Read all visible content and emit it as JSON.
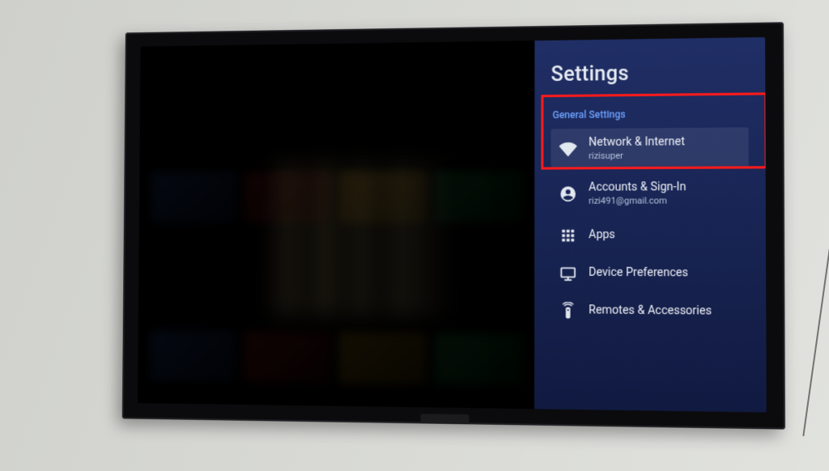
{
  "panel": {
    "title": "Settings",
    "section_header": "General Settings",
    "items": [
      {
        "id": "network-internet",
        "icon": "wifi-icon",
        "label": "Network & Internet",
        "sublabel": "rizisuper",
        "focused": true
      },
      {
        "id": "accounts-signin",
        "icon": "account-icon",
        "label": "Accounts & Sign-In",
        "sublabel": "rizi491@gmail.com",
        "focused": false
      },
      {
        "id": "apps",
        "icon": "apps-icon",
        "label": "Apps",
        "sublabel": null,
        "focused": false
      },
      {
        "id": "device-preferences",
        "icon": "display-icon",
        "label": "Device Preferences",
        "sublabel": null,
        "focused": false
      },
      {
        "id": "remotes-accessories",
        "icon": "remote-icon",
        "label": "Remotes & Accessories",
        "sublabel": null,
        "focused": false
      }
    ]
  },
  "colors": {
    "highlight_border": "#ff1a1a",
    "panel_accent": "#6fa3ff",
    "panel_bg_top": "rgba(34,50,110,.92)",
    "panel_bg_bottom": "rgba(18,28,70,.92)"
  }
}
